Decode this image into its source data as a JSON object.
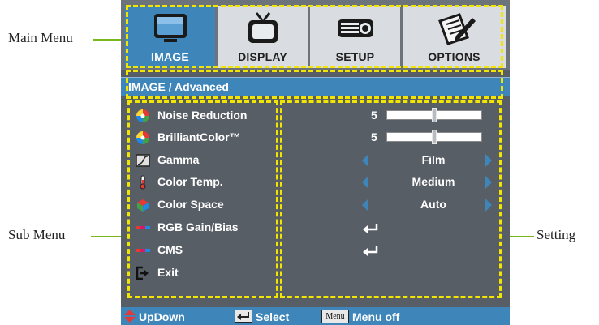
{
  "callouts": {
    "main_menu": "Main Menu",
    "sub_menu": "Sub Menu",
    "setting": "Setting"
  },
  "tabs": [
    {
      "label": "IMAGE",
      "icon": "monitor-icon",
      "active": true
    },
    {
      "label": "DISPLAY",
      "icon": "tv-icon",
      "active": false
    },
    {
      "label": "SETUP",
      "icon": "projector-icon",
      "active": false
    },
    {
      "label": "OPTIONS",
      "icon": "notepad-pencil-icon",
      "active": false
    }
  ],
  "breadcrumb": "IMAGE / Advanced",
  "items": [
    {
      "label": "Noise Reduction",
      "icon": "color-wheel-icon",
      "control": "slider",
      "number": "5",
      "level": 0.5
    },
    {
      "label": "BrilliantColor™",
      "icon": "color-wheel-icon",
      "control": "slider",
      "number": "5",
      "level": 0.5
    },
    {
      "label": "Gamma",
      "icon": "gamma-curve-icon",
      "control": "select",
      "value": "Film"
    },
    {
      "label": "Color Temp.",
      "icon": "thermometer-icon",
      "control": "select",
      "value": "Medium"
    },
    {
      "label": "Color Space",
      "icon": "color-cube-icon",
      "control": "select",
      "value": "Auto"
    },
    {
      "label": "RGB Gain/Bias",
      "icon": "rgb-bar-icon",
      "control": "enter"
    },
    {
      "label": "CMS",
      "icon": "rgb-bar-icon",
      "control": "enter"
    },
    {
      "label": "Exit",
      "icon": "exit-icon",
      "control": "none"
    }
  ],
  "footer": {
    "updown": "UpDown",
    "select": "Select",
    "menu_key": "Menu",
    "menu_off": "Menu off"
  },
  "colors": {
    "accent": "#3e86ba",
    "panel": "#585e66",
    "highlight_dash": "#f2e500",
    "callout_line": "#7ab61e"
  }
}
